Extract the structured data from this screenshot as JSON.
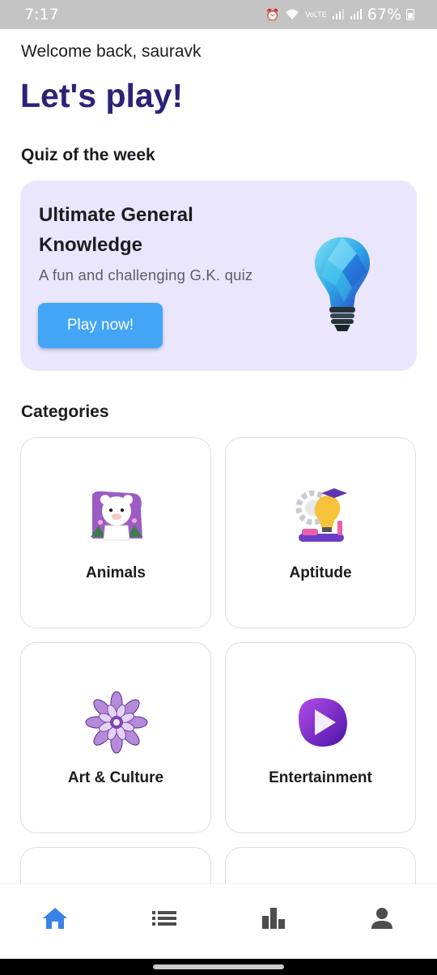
{
  "status_bar": {
    "time": "7:17",
    "battery": "67%",
    "icons": [
      "alarm-icon",
      "wifi-icon",
      "volte-icon",
      "signal-icon",
      "signal-icon",
      "battery-icon"
    ]
  },
  "header": {
    "greeting": "Welcome back, sauravk",
    "headline": "Let's play!"
  },
  "quiz_of_week": {
    "section_title": "Quiz of the week",
    "title": "Ultimate General Knowledge",
    "subtitle": "A fun and challenging G.K. quiz",
    "button_label": "Play now!",
    "image": "lightbulb-icon"
  },
  "categories": {
    "section_title": "Categories",
    "items": [
      {
        "label": "Animals",
        "icon": "panda-icon"
      },
      {
        "label": "Aptitude",
        "icon": "idea-gear-icon"
      },
      {
        "label": "Art & Culture",
        "icon": "mandala-icon"
      },
      {
        "label": "Entertainment",
        "icon": "play-icon"
      }
    ]
  },
  "bottom_nav": {
    "items": [
      {
        "icon": "home-icon",
        "active": true
      },
      {
        "icon": "list-icon",
        "active": false
      },
      {
        "icon": "leaderboard-icon",
        "active": false
      },
      {
        "icon": "profile-icon",
        "active": false
      }
    ]
  },
  "colors": {
    "headline": "#2b2278",
    "quiz_card_bg": "#e9e6fd",
    "play_button": "#42a5f5",
    "nav_active": "#3b82e6",
    "nav_inactive": "#4d4d4d",
    "status_bar": "#c4c4c4"
  }
}
